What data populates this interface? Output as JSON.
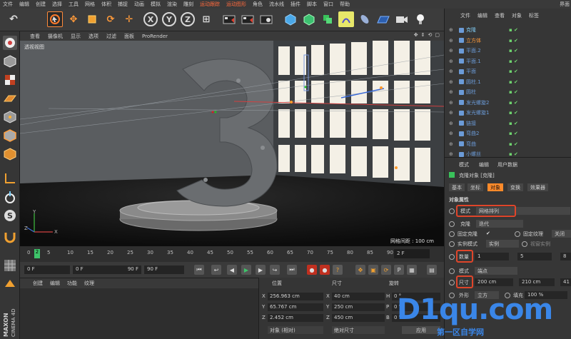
{
  "menubar": {
    "items": [
      "文件",
      "编辑",
      "创建",
      "选择",
      "工具",
      "网格",
      "体积",
      "捕捉",
      "动画",
      "模拟",
      "渲染",
      "雕刻",
      "运动跟踪",
      "运动图形",
      "角色",
      "流水线",
      "插件",
      "脚本",
      "窗口",
      "帮助"
    ],
    "right_label": "界面"
  },
  "toolbar": {
    "axis_x": "X",
    "axis_y": "Y",
    "axis_z": "Z"
  },
  "viewport_header": {
    "items": [
      "查看",
      "摄像机",
      "显示",
      "选项",
      "过滤",
      "面板",
      "ProRender"
    ]
  },
  "viewport": {
    "label": "透视视图",
    "grid_label": "网格间距 : 100 cm",
    "axis_z": "Z",
    "axis_x": "X",
    "axis_y": "Y"
  },
  "timeline": {
    "ticks": [
      "0",
      "5",
      "10",
      "15",
      "20",
      "25",
      "30",
      "35",
      "40",
      "45",
      "50",
      "55",
      "60",
      "65",
      "70",
      "75",
      "80",
      "85",
      "90"
    ],
    "current_frame": "2",
    "frame_field": "2 F"
  },
  "transport": {
    "start": "0 F",
    "preview_start": "0 F",
    "preview_end": "90 F",
    "end": "90 F"
  },
  "material_panel": {
    "tabs": [
      "创建",
      "编辑",
      "功能",
      "纹理"
    ]
  },
  "coordinates": {
    "heads": [
      "位置",
      "尺寸",
      "旋转"
    ],
    "rows": [
      {
        "axis": "X",
        "pos": "256.963 cm",
        "size": "40 cm",
        "rot_label": "H",
        "rot": "0 °"
      },
      {
        "axis": "Y",
        "pos": "65.767 cm",
        "size": "250 cm",
        "rot_label": "P",
        "rot": "0 °"
      },
      {
        "axis": "Z",
        "pos": "2.452 cm",
        "size": "450 cm",
        "rot_label": "B",
        "rot": "0 °"
      }
    ],
    "mode_left": "对象 (相对)",
    "mode_mid": "绝对尺寸",
    "apply": "应用"
  },
  "object_manager": {
    "tabs": [
      "文件",
      "编辑",
      "查看",
      "对象",
      "标签"
    ],
    "rows": [
      {
        "name": "克隆",
        "color": "#7ec8f0"
      },
      {
        "name": "立方体",
        "color": "#ff9a3a"
      },
      {
        "name": "平面.2",
        "color": "#6b9bd8"
      },
      {
        "name": "平面.1",
        "color": "#6b9bd8"
      },
      {
        "name": "平面",
        "color": "#6b9bd8"
      },
      {
        "name": "圆柱.1",
        "color": "#6b9bd8"
      },
      {
        "name": "圆柱",
        "color": "#6b9bd8"
      },
      {
        "name": "发光螺旋2",
        "color": "#6b9bd8"
      },
      {
        "name": "发光螺旋1",
        "color": "#6b9bd8"
      },
      {
        "name": "链接",
        "color": "#6b9bd8"
      },
      {
        "name": "弯曲2",
        "color": "#6b9bd8"
      },
      {
        "name": "弯曲",
        "color": "#6b9bd8"
      },
      {
        "name": "小螺丝",
        "color": "#6b9bd8"
      }
    ]
  },
  "attribute_manager": {
    "tabs_top": [
      "模式",
      "编辑",
      "用户数据"
    ],
    "title": "克隆对象 [克隆]",
    "tabs": [
      "基本",
      "坐标",
      "对象",
      "变换",
      "效果器"
    ],
    "active_tab": "对象",
    "section": "对象属性",
    "mode_label": "模式",
    "mode_value": "网格排列",
    "clone_label": "克隆",
    "clone_value": "迭代",
    "fix_clone": "固定克隆",
    "fix_texture": "固定纹理",
    "fix_texture_value": "关闭",
    "instance_label": "实例模式",
    "instance_value": "实例",
    "viewport_instance": "视窗实例",
    "count_label": "数量",
    "count": [
      "1",
      "5",
      "8"
    ],
    "mode2_label": "模式",
    "mode2_value": "端点",
    "size_label": "尺寸",
    "size": [
      "200 cm",
      "210 cm",
      "41"
    ],
    "shape_label": "外形",
    "shape_value": "立方",
    "fill_label": "填充",
    "fill_value": "100 %"
  },
  "watermark": {
    "big": "D1qu.com",
    "small": "第一区自学网"
  },
  "brand": {
    "maxon": "MAXON",
    "cinema": "CINEMA 4D"
  }
}
